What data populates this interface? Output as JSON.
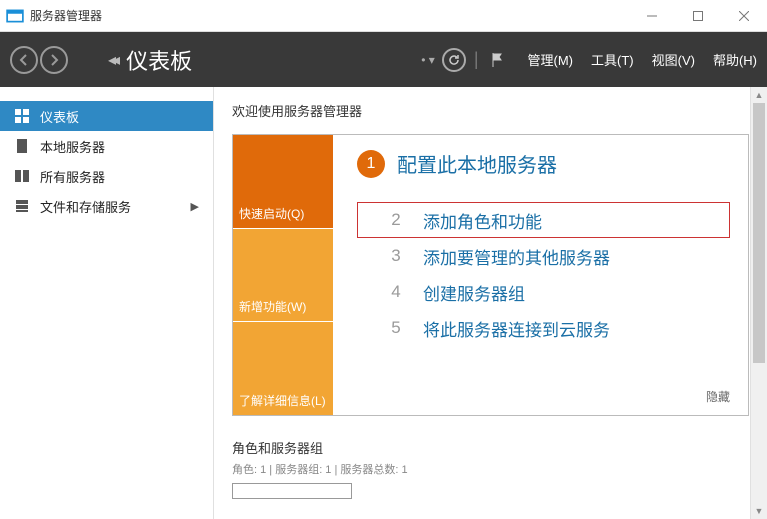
{
  "window": {
    "title": "服务器管理器"
  },
  "ribbon": {
    "title": "仪表板",
    "menus": {
      "manage": "管理(M)",
      "tools": "工具(T)",
      "view": "视图(V)",
      "help": "帮助(H)"
    }
  },
  "sidebar": {
    "items": [
      {
        "label": "仪表板"
      },
      {
        "label": "本地服务器"
      },
      {
        "label": "所有服务器"
      },
      {
        "label": "文件和存储服务"
      }
    ]
  },
  "welcome": {
    "heading": "欢迎使用服务器管理器",
    "tabs": {
      "quick": "快速启动(Q)",
      "whats": "新增功能(W)",
      "learn": "了解详细信息(L)"
    },
    "steps": {
      "s1_num": "1",
      "s1": "配置此本地服务器",
      "s2_num": "2",
      "s2": "添加角色和功能",
      "s3_num": "3",
      "s3": "添加要管理的其他服务器",
      "s4_num": "4",
      "s4": "创建服务器组",
      "s5_num": "5",
      "s5": "将此服务器连接到云服务"
    },
    "hide": "隐藏"
  },
  "roles": {
    "title": "角色和服务器组",
    "subtitle": "角色: 1 | 服务器组: 1 | 服务器总数: 1"
  }
}
